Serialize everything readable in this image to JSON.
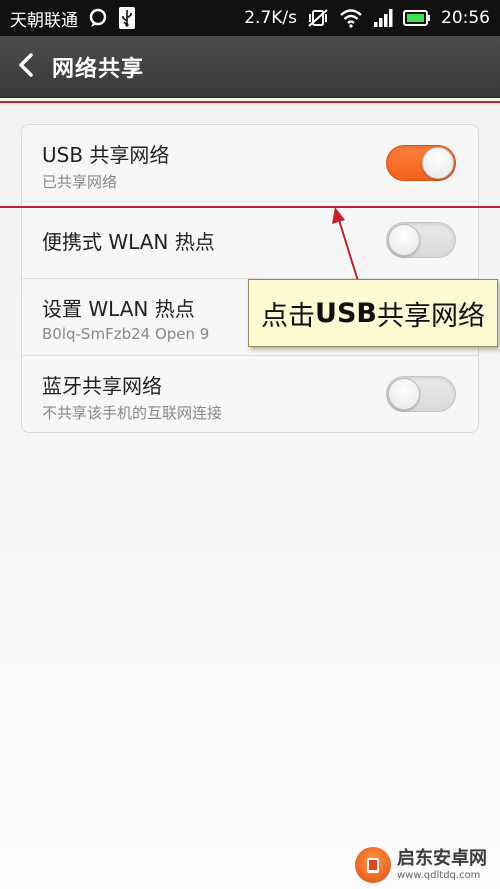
{
  "status_bar": {
    "carrier": "天朝联通",
    "speed": "2.7K/s",
    "time": "20:56"
  },
  "title_bar": {
    "title": "网络共享"
  },
  "settings": [
    {
      "title": "USB 共享网络",
      "subtitle": "已共享网络",
      "toggle_on": true
    },
    {
      "title": "便携式 WLAN 热点",
      "toggle_on": false
    },
    {
      "title": "设置 WLAN 热点",
      "subtitle": "B0lq-SmFzb24 Open 9"
    },
    {
      "title": "蓝牙共享网络",
      "subtitle": "不共享该手机的互联网连接",
      "toggle_on": false
    }
  ],
  "annotation": {
    "prefix": "点击",
    "bold": "USB",
    "suffix": "共享网络"
  },
  "watermark": {
    "name": "启东安卓网",
    "url": "www.qdltdq.com"
  },
  "colors": {
    "accent_orange": "#f26a24",
    "annotation_red": "#c2202a",
    "titlebar": "#424242"
  }
}
